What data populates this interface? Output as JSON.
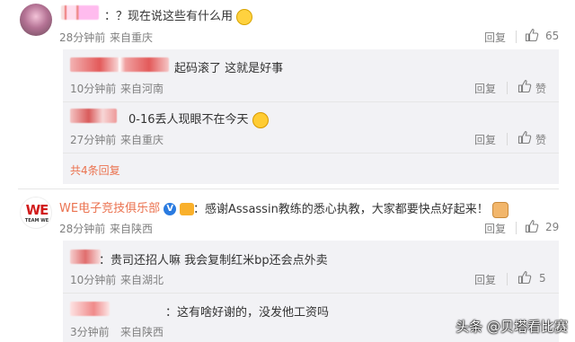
{
  "comments": [
    {
      "text": "：？现在说这些有什么用",
      "time": "28分钟前",
      "source": "来自重庆",
      "reply_label": "回复",
      "like_count": "65",
      "replies": [
        {
          "text": "起码滚了 这就是好事",
          "time": "10分钟前",
          "source": "来自河南",
          "reply_label": "回复",
          "like_label": "赞"
        },
        {
          "text": "0-16丢人现眼不在今天",
          "time": "27分钟前",
          "source": "来自重庆",
          "reply_label": "回复",
          "like_label": "赞"
        }
      ],
      "more_replies": "共4条回复"
    },
    {
      "author": "WE电子竞技俱乐部",
      "text": "：感谢Assassin教练的悉心执教，大家都要快点好起来！",
      "time": "28分钟前",
      "source": "来自陕西",
      "reply_label": "回复",
      "like_count": "29",
      "logo_text": "WE",
      "logo_sub": "TEAM WE",
      "replies": [
        {
          "text": "：贵司还招人嘛 我会复制红米bp还会点外卖",
          "time": "10分钟前",
          "source": "来自湖北",
          "reply_label": "回复",
          "like_count": "5"
        },
        {
          "text": "：这有啥好谢的，没发他工资吗",
          "time": "3分钟前",
          "source": "来自陕西"
        }
      ]
    }
  ],
  "watermark": "头条 @贝塔看比赛",
  "colors": {
    "accent": "#eb7350",
    "meta": "#808080",
    "sub_bg": "#f2f2f5"
  }
}
